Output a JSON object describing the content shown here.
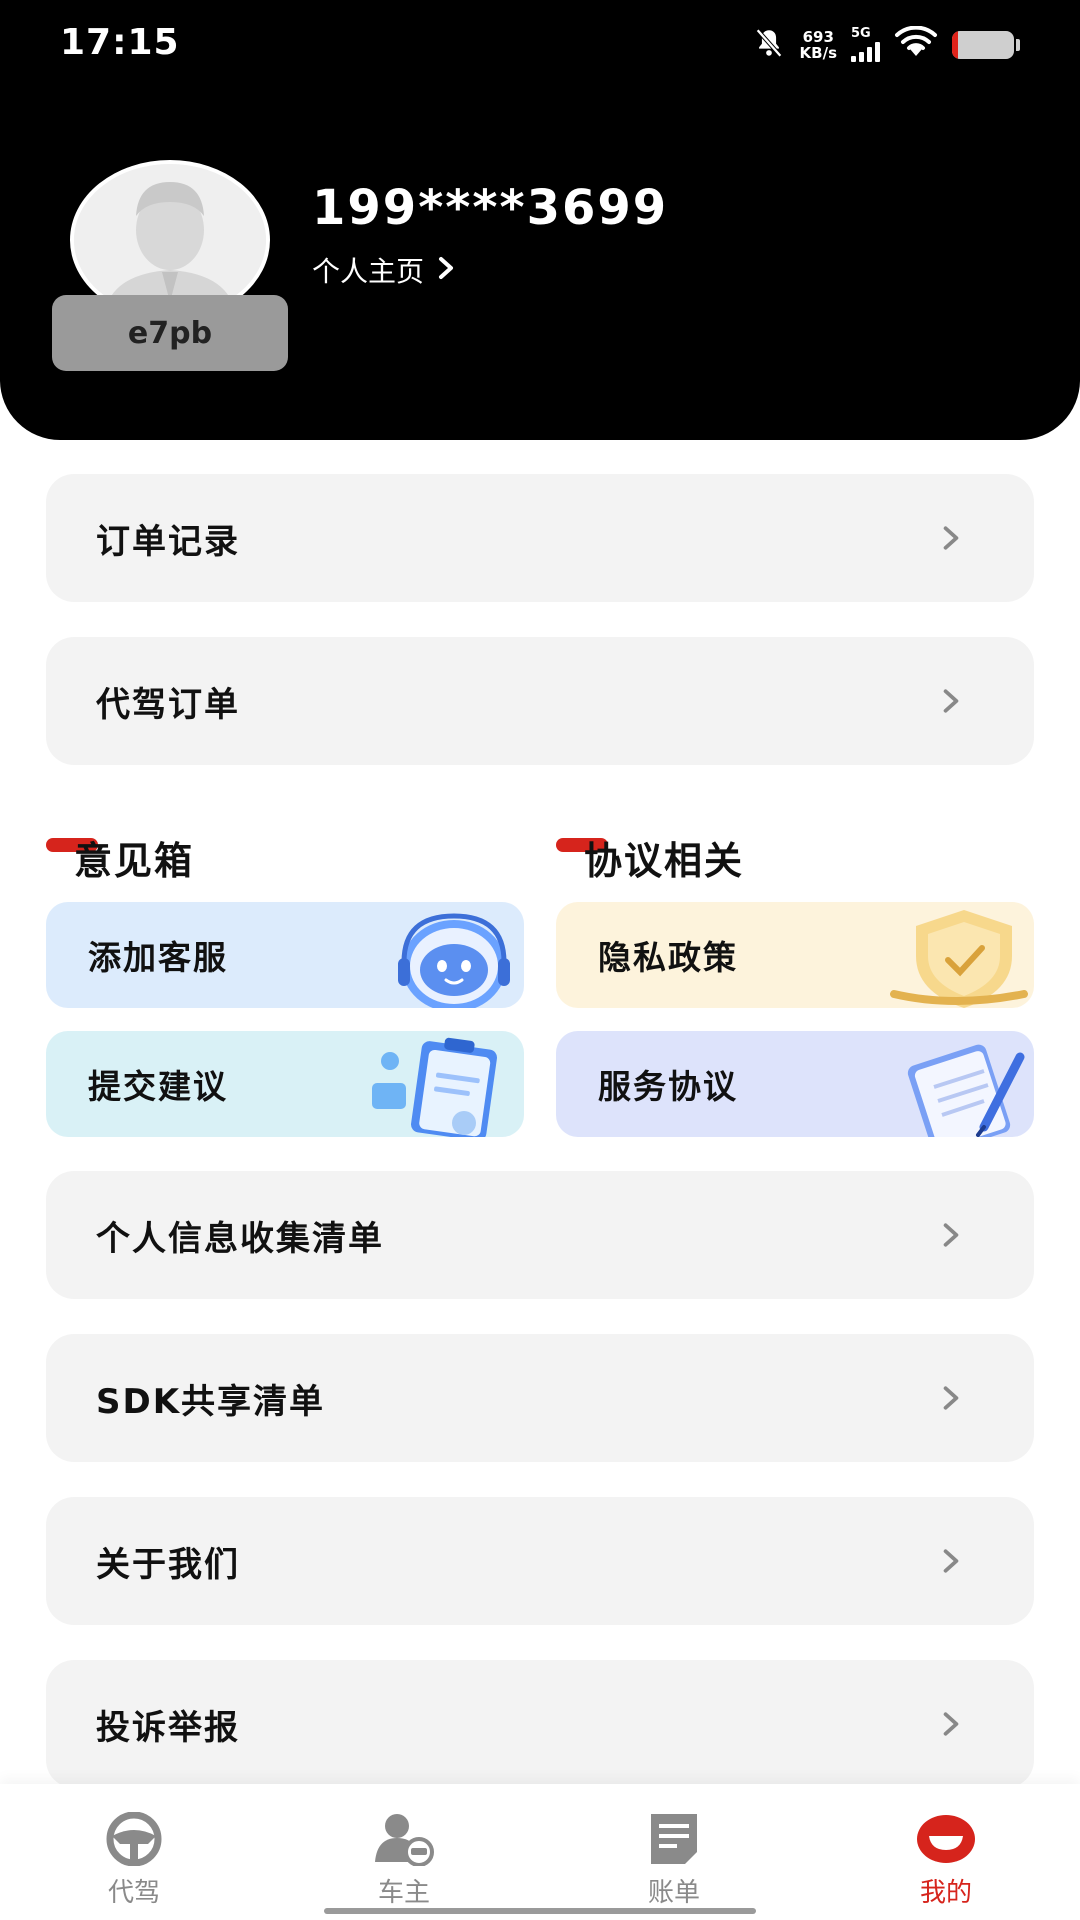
{
  "status_bar": {
    "time": "17:15",
    "net_speed_value": "693",
    "net_speed_unit": "KB/s",
    "network_type": "5G"
  },
  "profile": {
    "phone": "199****3699",
    "home_link": "个人主页",
    "nickname": "e7pb"
  },
  "rows_top": [
    {
      "label": "订单记录"
    },
    {
      "label": "代驾订单"
    }
  ],
  "sections": {
    "feedback_title": "意见箱",
    "agreements_title": "协议相关"
  },
  "cards": {
    "add_service": "添加客服",
    "privacy_policy": "隐私政策",
    "submit_suggestion": "提交建议",
    "service_agreement": "服务协议"
  },
  "rows_bottom": [
    {
      "label": "个人信息收集清单"
    },
    {
      "label": "SDK共享清单"
    },
    {
      "label": "关于我们"
    },
    {
      "label": "投诉举报"
    }
  ],
  "bottom_nav": {
    "items": [
      {
        "label": "代驾",
        "icon": "steering-wheel-icon"
      },
      {
        "label": "车主",
        "icon": "car-owner-icon"
      },
      {
        "label": "账单",
        "icon": "bill-icon"
      },
      {
        "label": "我的",
        "icon": "mine-icon",
        "active": true
      }
    ]
  },
  "colors": {
    "accent": "#d6241c",
    "header_bg": "#000000",
    "row_bg": "#f3f3f3"
  }
}
